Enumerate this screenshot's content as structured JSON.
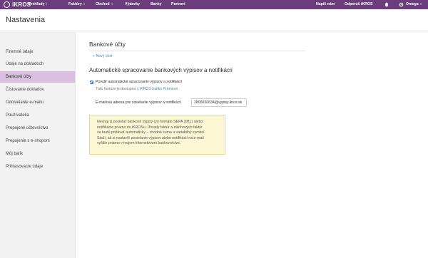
{
  "app": {
    "logo_text": "iKROS"
  },
  "topnav": {
    "left": [
      {
        "label": "Prehľady",
        "has_caret": true
      },
      {
        "label": "Faktúry",
        "has_caret": true
      },
      {
        "label": "Obchod",
        "has_caret": true
      },
      {
        "label": "Výdavky",
        "has_caret": false
      },
      {
        "label": "Banky",
        "has_caret": false
      },
      {
        "label": "Partneri",
        "has_caret": false
      }
    ],
    "right": {
      "contact": "Napíš nám",
      "recommend": "Odporuč iKROS",
      "bell_icon": "bell-icon",
      "user_icon": "gear-icon",
      "user": "Omega"
    }
  },
  "page": {
    "title": "Nastavenia"
  },
  "sidebar": {
    "items": [
      {
        "label": "Firemné údaje",
        "active": false
      },
      {
        "label": "Údaje na dokladoch",
        "active": false
      },
      {
        "label": "Bankové účty",
        "active": true
      },
      {
        "label": "Číslovanie dokladov",
        "active": false
      },
      {
        "label": "Odosielanie e-mailu",
        "active": false
      },
      {
        "label": "Používatelia",
        "active": false
      },
      {
        "label": "Prepojené účtovníctvo",
        "active": false
      },
      {
        "label": "Prepojenie s e-shopom",
        "active": false
      },
      {
        "label": "Môj balík",
        "active": false
      },
      {
        "label": "Prihlasovacie údaje",
        "active": false
      }
    ]
  },
  "main": {
    "section_title": "Bankové účty",
    "new_account": "+ Nový účet",
    "auto_title": "Automatické spracovanie bankových výpisov a notifikácií",
    "checkbox_label": "Povoliť automatické spracovanie výpisov a notifikácií",
    "checkbox_checked": true,
    "note_prefix": "Táto funkcia je dostupná v",
    "note_link": "iKROS balíku Prémium",
    "note_suffix": ".",
    "email_label": "E-mailová adresa pre zasielanie výpisov a notifikácií",
    "email_value": "2800020634@vypisy.ikros.sk",
    "info_lines": [
      "Nechaj si posielať bankové výpisy (vo formáte SEPA XML) alebo",
      "notifikácie priamo do iKROSu. Úhrady faktúr a zálohových faktúr",
      "sa budú pridávať automaticky – zhodná suma a variabilný symbol.",
      "Stačí, ak si nastavíš posielanie výpisov alebo notifikácií na e-mail",
      "vyššie priamo v tvojom internetovom bankovníctve."
    ]
  },
  "colors": {
    "topbar": "#6b3d7c",
    "sidebar_active": "#d9bfe0",
    "link": "#3b8ac4",
    "info_bg": "#fdf8d4"
  }
}
